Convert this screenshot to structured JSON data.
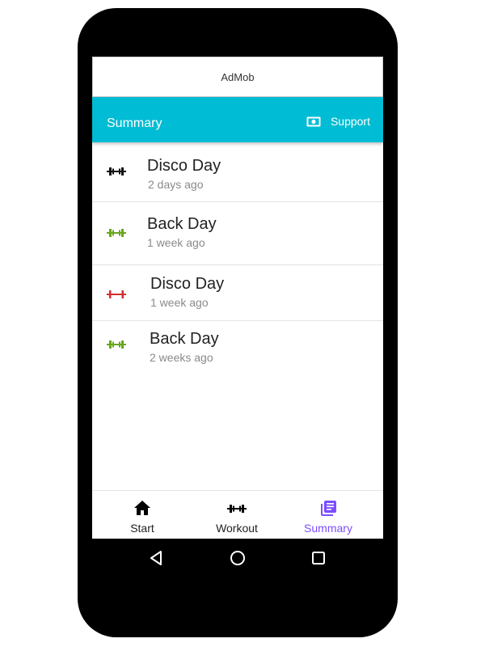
{
  "ad_banner": {
    "label": "AdMob"
  },
  "appbar": {
    "title": "Summary",
    "support_label": "Support",
    "color": "#00bcd4"
  },
  "workouts": [
    {
      "title": "Disco Day",
      "time": "2 days ago",
      "icon": "dumbbell-icon",
      "icon_color": "#111111"
    },
    {
      "title": "Back Day",
      "time": "1 week ago",
      "icon": "dumbbell-icon",
      "icon_color": "#6aa51e"
    },
    {
      "title": "Disco Day",
      "time": "1 week ago",
      "icon": "dumbbell-icon",
      "icon_color": "#d32f2f"
    },
    {
      "title": "Back Day",
      "time": "2 weeks ago",
      "icon": "dumbbell-icon",
      "icon_color": "#6aa51e"
    }
  ],
  "bottom_nav": {
    "items": [
      {
        "label": "Start",
        "icon": "home-icon"
      },
      {
        "label": "Workout",
        "icon": "dumbbell-icon"
      },
      {
        "label": "Summary",
        "icon": "library-books-icon"
      }
    ],
    "active": "Summary",
    "active_color": "#7c4dff"
  },
  "system_nav": {
    "buttons": [
      "back-icon",
      "home-circle-icon",
      "recents-icon"
    ]
  }
}
